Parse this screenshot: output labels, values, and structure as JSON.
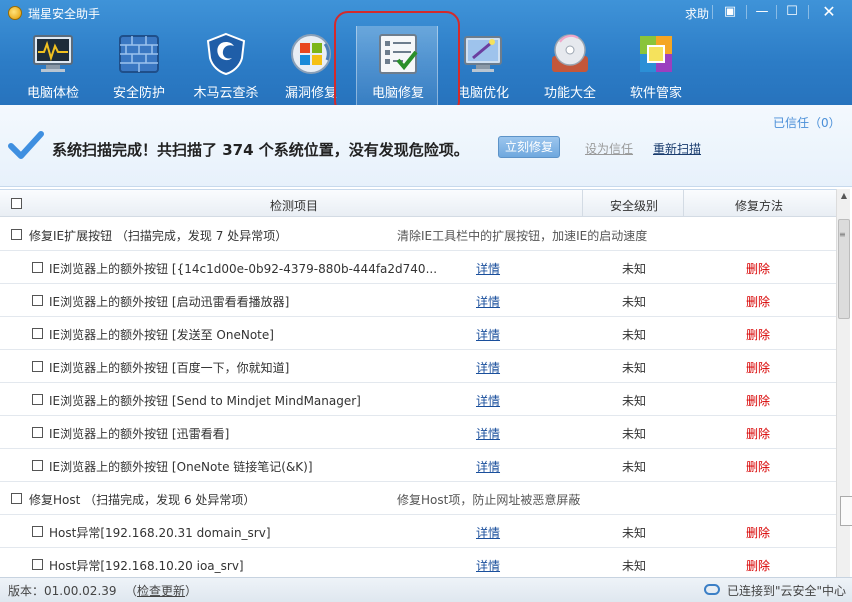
{
  "window": {
    "title": "瑞星安全助手",
    "help_label": "求助",
    "controls": [
      "▣",
      "—",
      "☐",
      "✕"
    ]
  },
  "nav": {
    "items": [
      {
        "label": "电脑体检",
        "icon": "monitor-pulse-icon",
        "active": false
      },
      {
        "label": "安全防护",
        "icon": "firewall-icon",
        "active": false
      },
      {
        "label": "木马云查杀",
        "icon": "shield-icon",
        "active": false
      },
      {
        "label": "漏洞修复",
        "icon": "windows-update-icon",
        "active": false
      },
      {
        "label": "电脑修复",
        "icon": "checklist-icon",
        "active": true
      },
      {
        "label": "电脑优化",
        "icon": "magic-wand-monitor-icon",
        "active": false
      },
      {
        "label": "功能大全",
        "icon": "disc-toolbox-icon",
        "active": false
      },
      {
        "label": "软件管家",
        "icon": "software-blocks-icon",
        "active": false
      }
    ]
  },
  "status": {
    "trusted": "已信任（0）",
    "message": "系统扫描完成！共扫描了 374 个系统位置，没有发现危险项。",
    "fix_button": "立刻修复",
    "set_trust": "设为信任",
    "rescan": "重新扫描"
  },
  "table": {
    "headers": {
      "item": "检测项目",
      "level": "安全级别",
      "method": "修复方法"
    },
    "rows": [
      {
        "kind": "group",
        "label": "修复IE扩展按钮 （扫描完成，发现 7 处异常项）",
        "desc": "清除IE工具栏中的扩展按钮，加速IE的启动速度"
      },
      {
        "kind": "item",
        "label": "IE浏览器上的额外按钮 [{14c1d00e-0b92-4379-880b-444fa2d740...",
        "detail": "详情",
        "level": "未知",
        "action": "删除"
      },
      {
        "kind": "item",
        "label": "IE浏览器上的额外按钮 [启动迅雷看看播放器]",
        "detail": "详情",
        "level": "未知",
        "action": "删除"
      },
      {
        "kind": "item",
        "label": "IE浏览器上的额外按钮 [发送至 OneNote]",
        "detail": "详情",
        "level": "未知",
        "action": "删除"
      },
      {
        "kind": "item",
        "label": "IE浏览器上的额外按钮 [百度一下，你就知道]",
        "detail": "详情",
        "level": "未知",
        "action": "删除"
      },
      {
        "kind": "item",
        "label": "IE浏览器上的额外按钮 [Send to Mindjet MindManager]",
        "detail": "详情",
        "level": "未知",
        "action": "删除"
      },
      {
        "kind": "item",
        "label": "IE浏览器上的额外按钮 [迅雷看看]",
        "detail": "详情",
        "level": "未知",
        "action": "删除"
      },
      {
        "kind": "item",
        "label": "IE浏览器上的额外按钮 [OneNote 链接笔记(&K)]",
        "detail": "详情",
        "level": "未知",
        "action": "删除"
      },
      {
        "kind": "group",
        "label": "修复Host （扫描完成，发现 6 处异常项）",
        "desc": "修复Host项，防止网址被恶意屏蔽"
      },
      {
        "kind": "item",
        "label": "Host异常[192.168.20.31 domain_srv]",
        "detail": "详情",
        "level": "未知",
        "action": "删除"
      },
      {
        "kind": "item",
        "label": "Host异常[192.168.10.20 ioa_srv]",
        "detail": "详情",
        "level": "未知",
        "action": "删除"
      }
    ]
  },
  "footer": {
    "version": "版本：01.00.02.39",
    "update_open": "（",
    "update_link": "检查更新",
    "update_close": "）",
    "connection": "已连接到\"云安全\"中心"
  },
  "colors": {
    "header_blue": "#2c7cc6",
    "highlight_red": "#d42a2a",
    "delete_red": "#d80000",
    "link_blue": "#1a4f9c"
  }
}
